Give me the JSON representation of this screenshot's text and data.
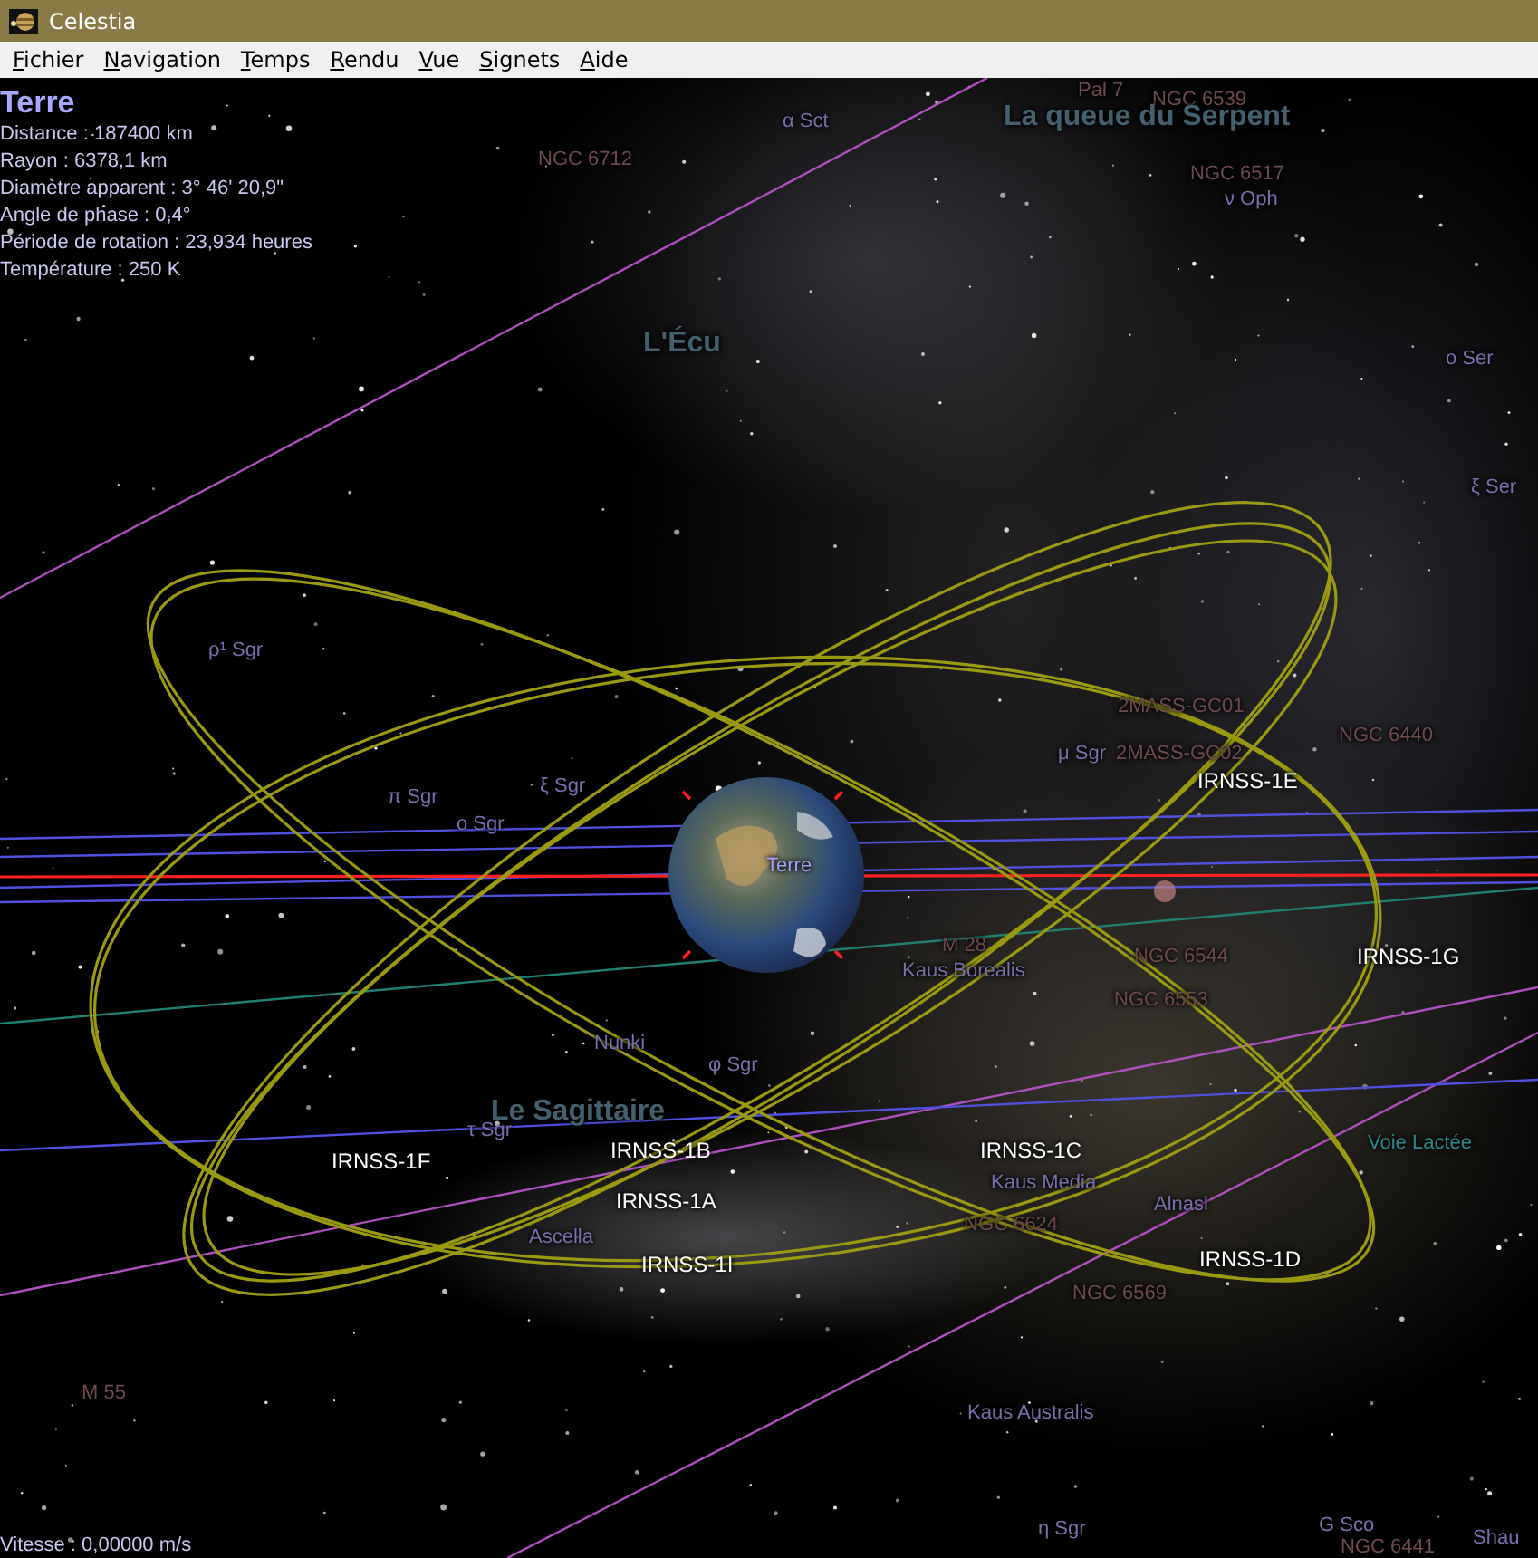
{
  "window": {
    "title": "Celestia"
  },
  "menu": [
    "Fichier",
    "Navigation",
    "Temps",
    "Rendu",
    "Vue",
    "Signets",
    "Aide"
  ],
  "info": {
    "name": "Terre",
    "lines": [
      "Distance : 187400 km",
      "Rayon : 6378,1 km",
      "Diamètre apparent : 3° 46' 20,9\"",
      "Angle de phase : 0,4°",
      "Période de rotation : 23,934 heures",
      "Température : 250 K"
    ]
  },
  "labels": [
    {
      "text": "Pal 7",
      "kind": "dso"
    },
    {
      "text": "NGC 6539",
      "kind": "dso"
    },
    {
      "text": "α Sct",
      "kind": "star"
    },
    {
      "text": "La queue du Serpent",
      "kind": "constellation"
    },
    {
      "text": "NGC 6712",
      "kind": "dso"
    },
    {
      "text": "NGC 6517",
      "kind": "dso"
    },
    {
      "text": "ν Oph",
      "kind": "star"
    },
    {
      "text": "L'Écu",
      "kind": "constellation"
    },
    {
      "text": "ο Ser",
      "kind": "star"
    },
    {
      "text": "ξ Ser",
      "kind": "star"
    },
    {
      "text": "ρ¹ Sgr",
      "kind": "star"
    },
    {
      "text": "2MASS-GC01",
      "kind": "dso"
    },
    {
      "text": "μ Sgr",
      "kind": "star"
    },
    {
      "text": "2MASS-GC02",
      "kind": "dso"
    },
    {
      "text": "NGC 6440",
      "kind": "dso"
    },
    {
      "text": "IRNSS-1E",
      "kind": "satellite"
    },
    {
      "text": "π Sgr",
      "kind": "star"
    },
    {
      "text": "ξ Sgr",
      "kind": "star"
    },
    {
      "text": "ο Sgr",
      "kind": "star"
    },
    {
      "text": "Terre",
      "kind": "planet"
    },
    {
      "text": "M 28",
      "kind": "dso"
    },
    {
      "text": "Kaus Borealis",
      "kind": "star"
    },
    {
      "text": "NGC 6544",
      "kind": "dso"
    },
    {
      "text": "IRNSS-1G",
      "kind": "satellite"
    },
    {
      "text": "NGC 6553",
      "kind": "dso"
    },
    {
      "text": "Nunki",
      "kind": "star"
    },
    {
      "text": "φ Sgr",
      "kind": "star"
    },
    {
      "text": "Le Sagittaire",
      "kind": "constellation"
    },
    {
      "text": "τ Sgr",
      "kind": "star"
    },
    {
      "text": "IRNSS-1F",
      "kind": "satellite"
    },
    {
      "text": "IRNSS-1B",
      "kind": "satellite"
    },
    {
      "text": "IRNSS-1C",
      "kind": "satellite"
    },
    {
      "text": "Voie Lactée",
      "kind": "galaxy"
    },
    {
      "text": "Kaus Media",
      "kind": "star"
    },
    {
      "text": "IRNSS-1A",
      "kind": "satellite"
    },
    {
      "text": "Alnasl",
      "kind": "star"
    },
    {
      "text": "NGC 6624",
      "kind": "dso"
    },
    {
      "text": "Ascella",
      "kind": "star"
    },
    {
      "text": "IRNSS-1I",
      "kind": "satellite"
    },
    {
      "text": "IRNSS-1D",
      "kind": "satellite"
    },
    {
      "text": "NGC 6569",
      "kind": "dso"
    },
    {
      "text": "M 55",
      "kind": "dso"
    },
    {
      "text": "Kaus Australis",
      "kind": "star"
    },
    {
      "text": "η Sgr",
      "kind": "star"
    },
    {
      "text": "G Sco",
      "kind": "star"
    },
    {
      "text": "NGC 6441",
      "kind": "dso"
    },
    {
      "text": "Shau",
      "kind": "star"
    }
  ],
  "status": "Vitesse : 0,00000 m/s"
}
